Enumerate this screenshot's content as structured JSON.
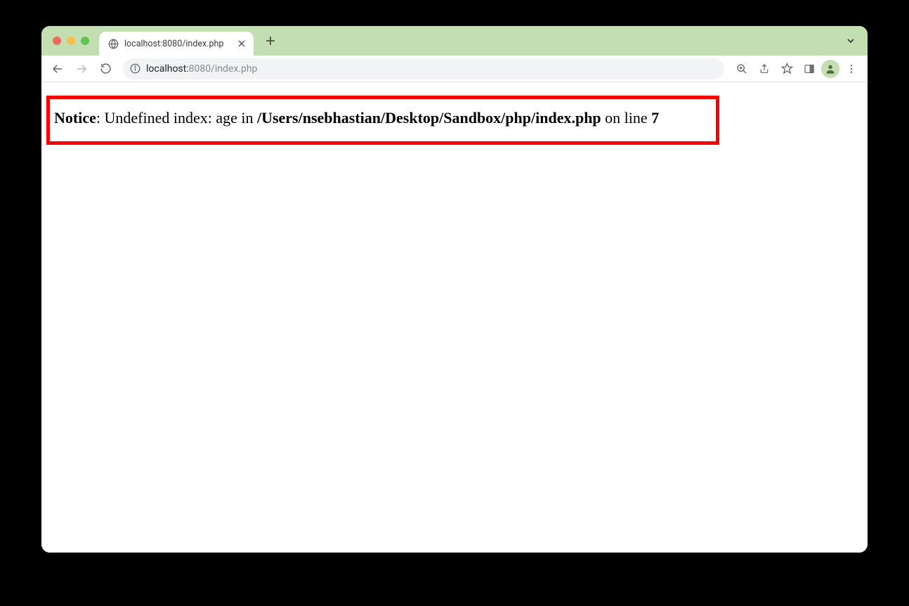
{
  "tab": {
    "title": "localhost:8080/index.php"
  },
  "addressbar": {
    "host": "localhost:",
    "path": "8080/index.php"
  },
  "page": {
    "notice_label": "Notice",
    "message_prefix": ": Undefined index: age in ",
    "file_path": "/Users/nsebhastian/Desktop/Sandbox/php/index.php",
    "on_line_text": " on line ",
    "line_number": "7"
  }
}
